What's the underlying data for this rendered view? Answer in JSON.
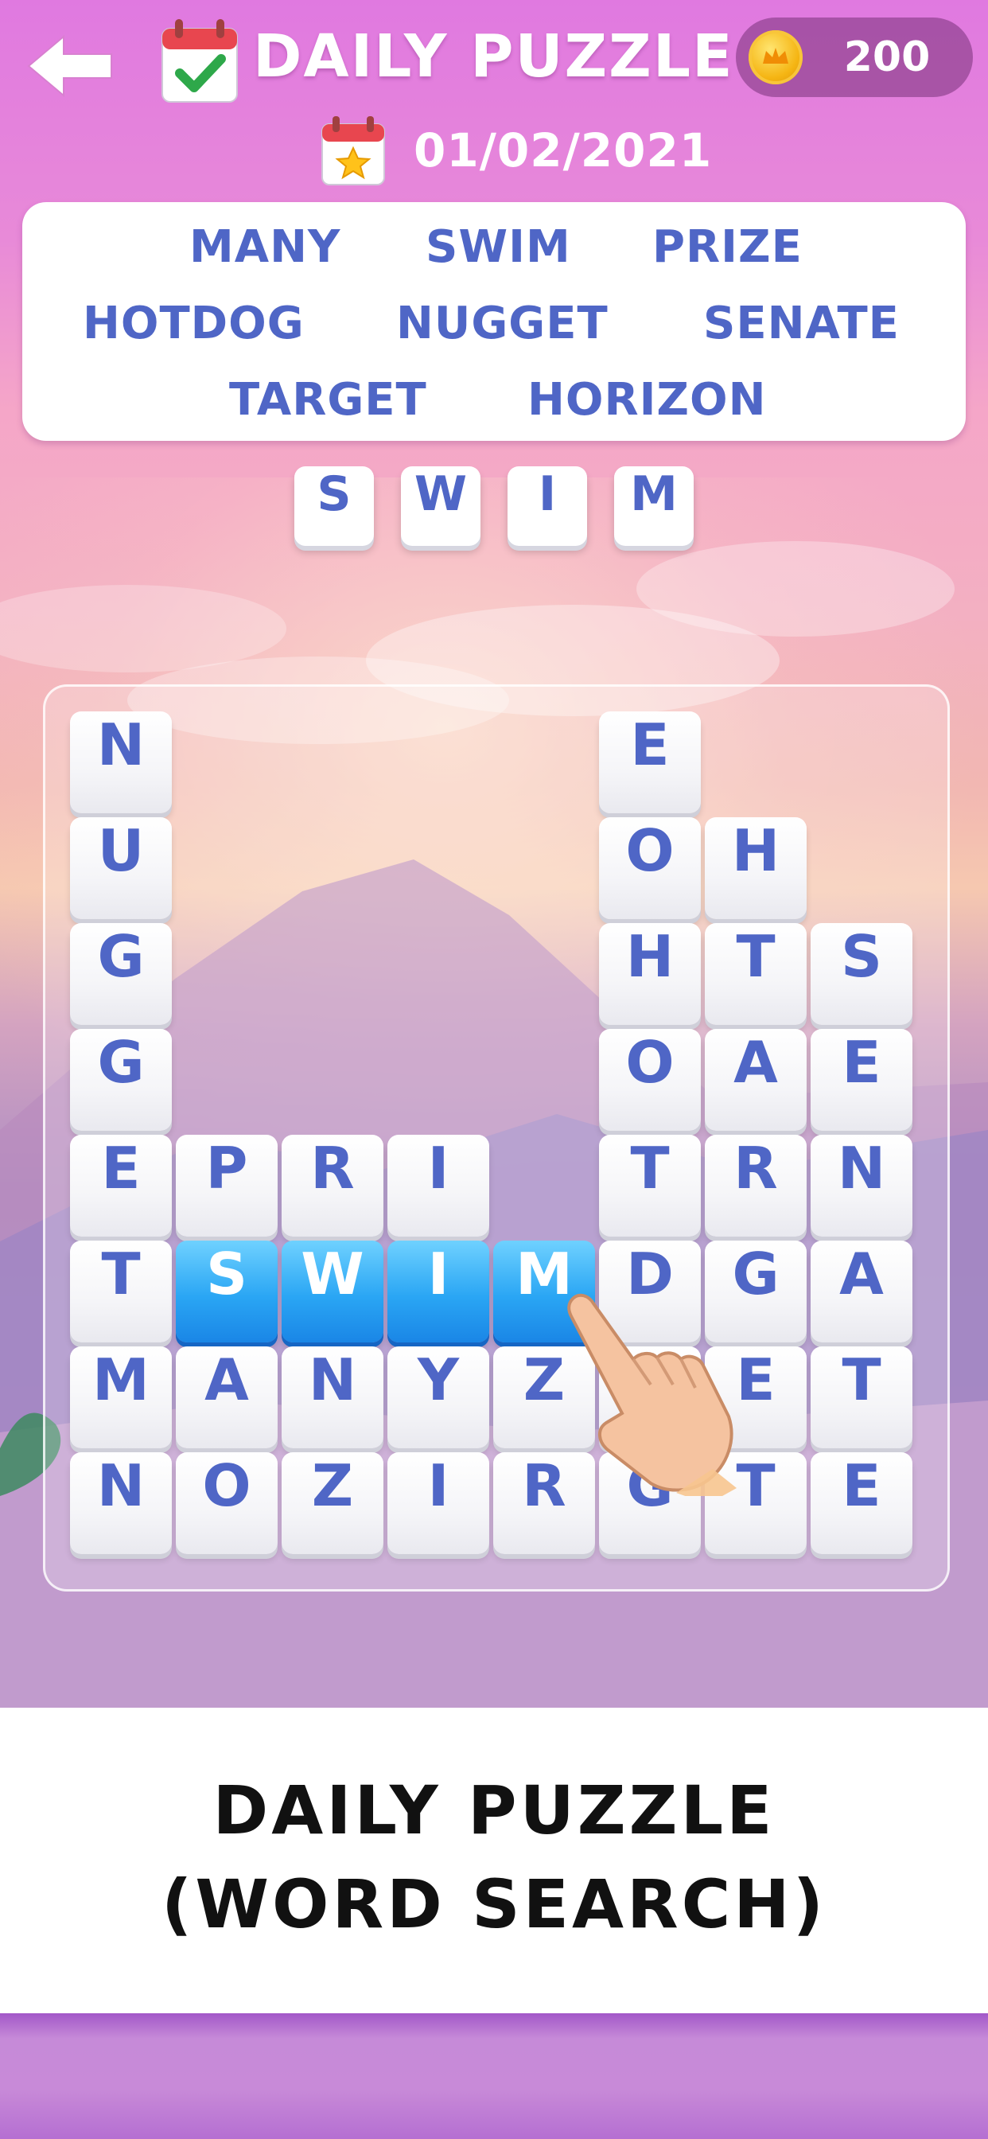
{
  "header": {
    "back_icon": "back-arrow-icon",
    "calendar_icon": "calendar-check-icon",
    "title": "DAILY PUZZLE",
    "coins": "200",
    "coin_icon": "crown-coin-icon"
  },
  "date": {
    "icon": "calendar-star-icon",
    "value": "01/02/2021"
  },
  "word_list": {
    "row1": [
      "MANY",
      "SWIM",
      "PRIZE"
    ],
    "row2": [
      "HOTDOG",
      "NUGGET",
      "SENATE"
    ],
    "row3": [
      "TARGET",
      "HORIZON"
    ]
  },
  "selection": [
    "S",
    "W",
    "I",
    "M"
  ],
  "grid": [
    [
      "N",
      "",
      "",
      "",
      "",
      "E",
      "",
      ""
    ],
    [
      "U",
      "",
      "",
      "",
      "",
      "O",
      "H",
      ""
    ],
    [
      "G",
      "",
      "",
      "",
      "",
      "H",
      "T",
      "S"
    ],
    [
      "G",
      "",
      "",
      "",
      "",
      "O",
      "A",
      "E"
    ],
    [
      "E",
      "P",
      "R",
      "I",
      "",
      "T",
      "R",
      "N"
    ],
    [
      "T",
      "S",
      "W",
      "I",
      "M",
      "D",
      "G",
      "A"
    ],
    [
      "M",
      "A",
      "N",
      "Y",
      "Z",
      "O",
      "E",
      "T"
    ],
    [
      "N",
      "O",
      "Z",
      "I",
      "R",
      "G",
      "T",
      "E"
    ]
  ],
  "highlighted": [
    [
      5,
      1
    ],
    [
      5,
      2
    ],
    [
      5,
      3
    ],
    [
      5,
      4
    ]
  ],
  "colors": {
    "tile_text": "#4f66c6",
    "highlight": "#2aa6f4",
    "coin_pill": "#7a3278"
  },
  "caption": {
    "line1": "DAILY PUZZLE",
    "line2": "(WORD SEARCH)"
  }
}
